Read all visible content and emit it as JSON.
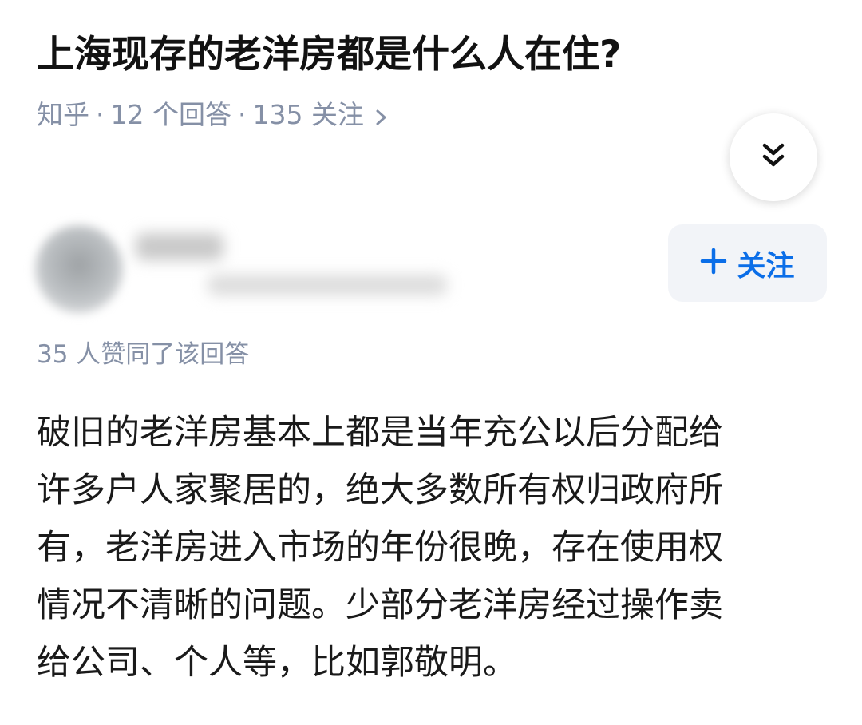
{
  "question": {
    "title": "上海现存的老洋房都是什么人在住?",
    "meta": {
      "source": "知乎",
      "answers": "12 个回答",
      "followers": "135 关注"
    }
  },
  "answer": {
    "author": {
      "name": "",
      "bio": ""
    },
    "follow_label": "关注",
    "votes_text": "35 人赞同了该回答",
    "content_lines": [
      "破旧的老洋房基本上都是当年充公以后分配给",
      "许多户人家聚居的，绝大多数所有权归政府所",
      "有，老洋房进入市场的年份很晚，存在使用权",
      "情况不清晰的问题。少部分老洋房经过操作卖",
      "给公司、个人等，比如郭敬明。"
    ]
  },
  "icons": {
    "expand": "double-chevron-down-icon",
    "meta_arrow": "chevron-right-icon",
    "follow": "plus-icon"
  },
  "colors": {
    "accent": "#0b6ee8",
    "meta": "#8590a6",
    "follow_bg": "#f2f4f8"
  }
}
